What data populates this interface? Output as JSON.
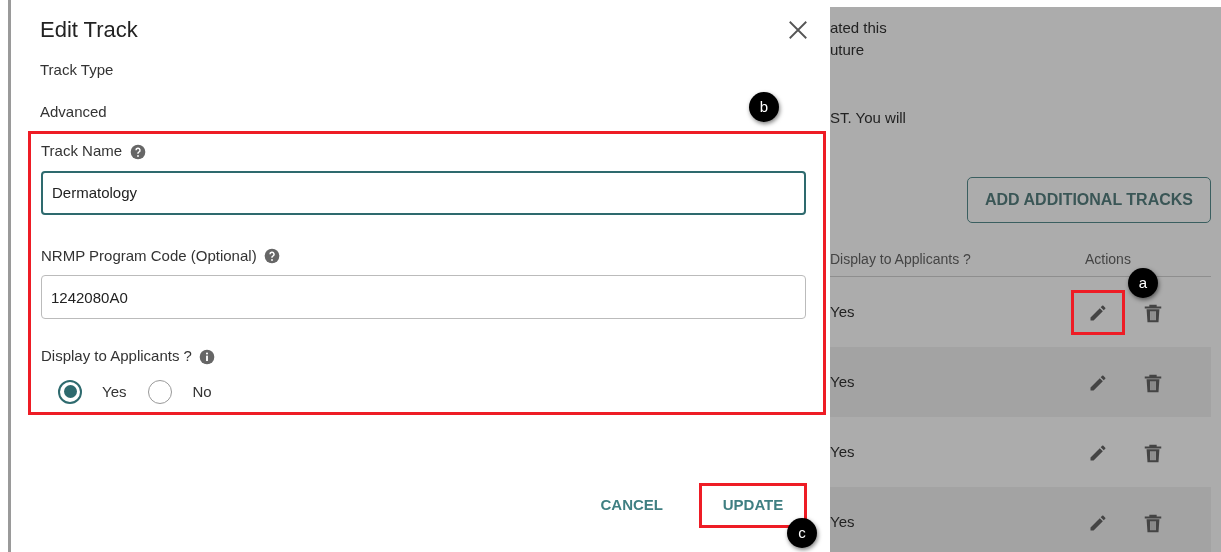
{
  "dialog": {
    "title": "Edit Track",
    "track_type_label": "Track Type",
    "track_type_value": "Advanced",
    "form_highlighted": true,
    "fields": [
      {
        "label": "Track Name",
        "value": "Dermatology",
        "focused": true
      },
      {
        "label": "NRMP Program Code (Optional)",
        "value": "1242080A0",
        "focused": false
      }
    ],
    "display": {
      "label": "Display to Applicants ?",
      "options": [
        {
          "label": "Yes",
          "selected": true
        },
        {
          "label": "No",
          "selected": false
        }
      ]
    },
    "buttons": [
      {
        "label": "CANCEL",
        "highlighted": false
      },
      {
        "label": "UPDATE",
        "highlighted": true
      }
    ]
  },
  "background": {
    "text_lines": [
      "ated this",
      "uture",
      "ST. You will"
    ],
    "add_button": "ADD ADDITIONAL TRACKS",
    "columns": [
      "Display to Applicants ?",
      "Actions"
    ],
    "rows": [
      {
        "display": "Yes",
        "edit_highlighted": true
      },
      {
        "display": "Yes",
        "edit_highlighted": false
      },
      {
        "display": "Yes",
        "edit_highlighted": false
      },
      {
        "display": "Yes",
        "edit_highlighted": false
      }
    ]
  },
  "callouts": [
    {
      "label": "b"
    },
    {
      "label": "a"
    },
    {
      "label": "c"
    }
  ]
}
